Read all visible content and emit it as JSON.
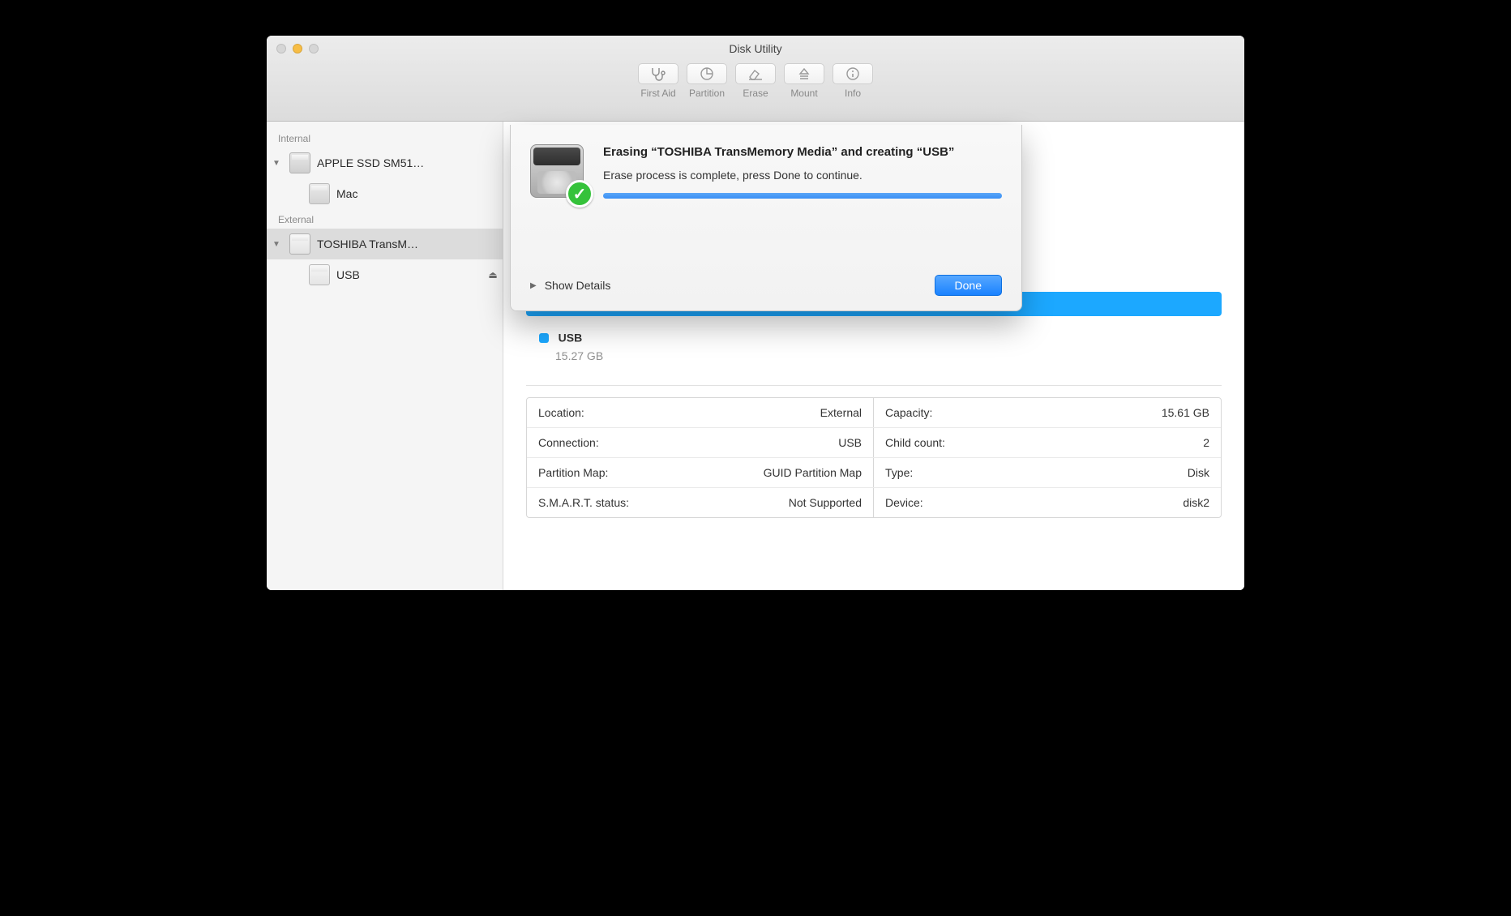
{
  "window": {
    "title": "Disk Utility"
  },
  "toolbar": [
    {
      "label": "First Aid"
    },
    {
      "label": "Partition"
    },
    {
      "label": "Erase"
    },
    {
      "label": "Mount"
    },
    {
      "label": "Info"
    }
  ],
  "sidebar": {
    "groups": [
      {
        "label": "Internal",
        "items": [
          {
            "label": "APPLE SSD SM51…",
            "children": [
              {
                "label": "Mac"
              }
            ]
          }
        ]
      },
      {
        "label": "External",
        "items": [
          {
            "label": "TOSHIBA TransM…",
            "selected": true,
            "children": [
              {
                "label": "USB",
                "ejectable": true
              }
            ]
          }
        ]
      }
    ]
  },
  "main": {
    "volume": {
      "name": "USB",
      "size": "15.27 GB"
    },
    "props_left": [
      {
        "key": "Location:",
        "val": "External"
      },
      {
        "key": "Connection:",
        "val": "USB"
      },
      {
        "key": "Partition Map:",
        "val": "GUID Partition Map"
      },
      {
        "key": "S.M.A.R.T. status:",
        "val": "Not Supported"
      }
    ],
    "props_right": [
      {
        "key": "Capacity:",
        "val": "15.61 GB"
      },
      {
        "key": "Child count:",
        "val": "2"
      },
      {
        "key": "Type:",
        "val": "Disk"
      },
      {
        "key": "Device:",
        "val": "disk2"
      }
    ]
  },
  "dialog": {
    "title": "Erasing “TOSHIBA TransMemory Media” and creating “USB”",
    "subtitle": "Erase process is complete, press Done to continue.",
    "show_details": "Show Details",
    "done": "Done"
  }
}
